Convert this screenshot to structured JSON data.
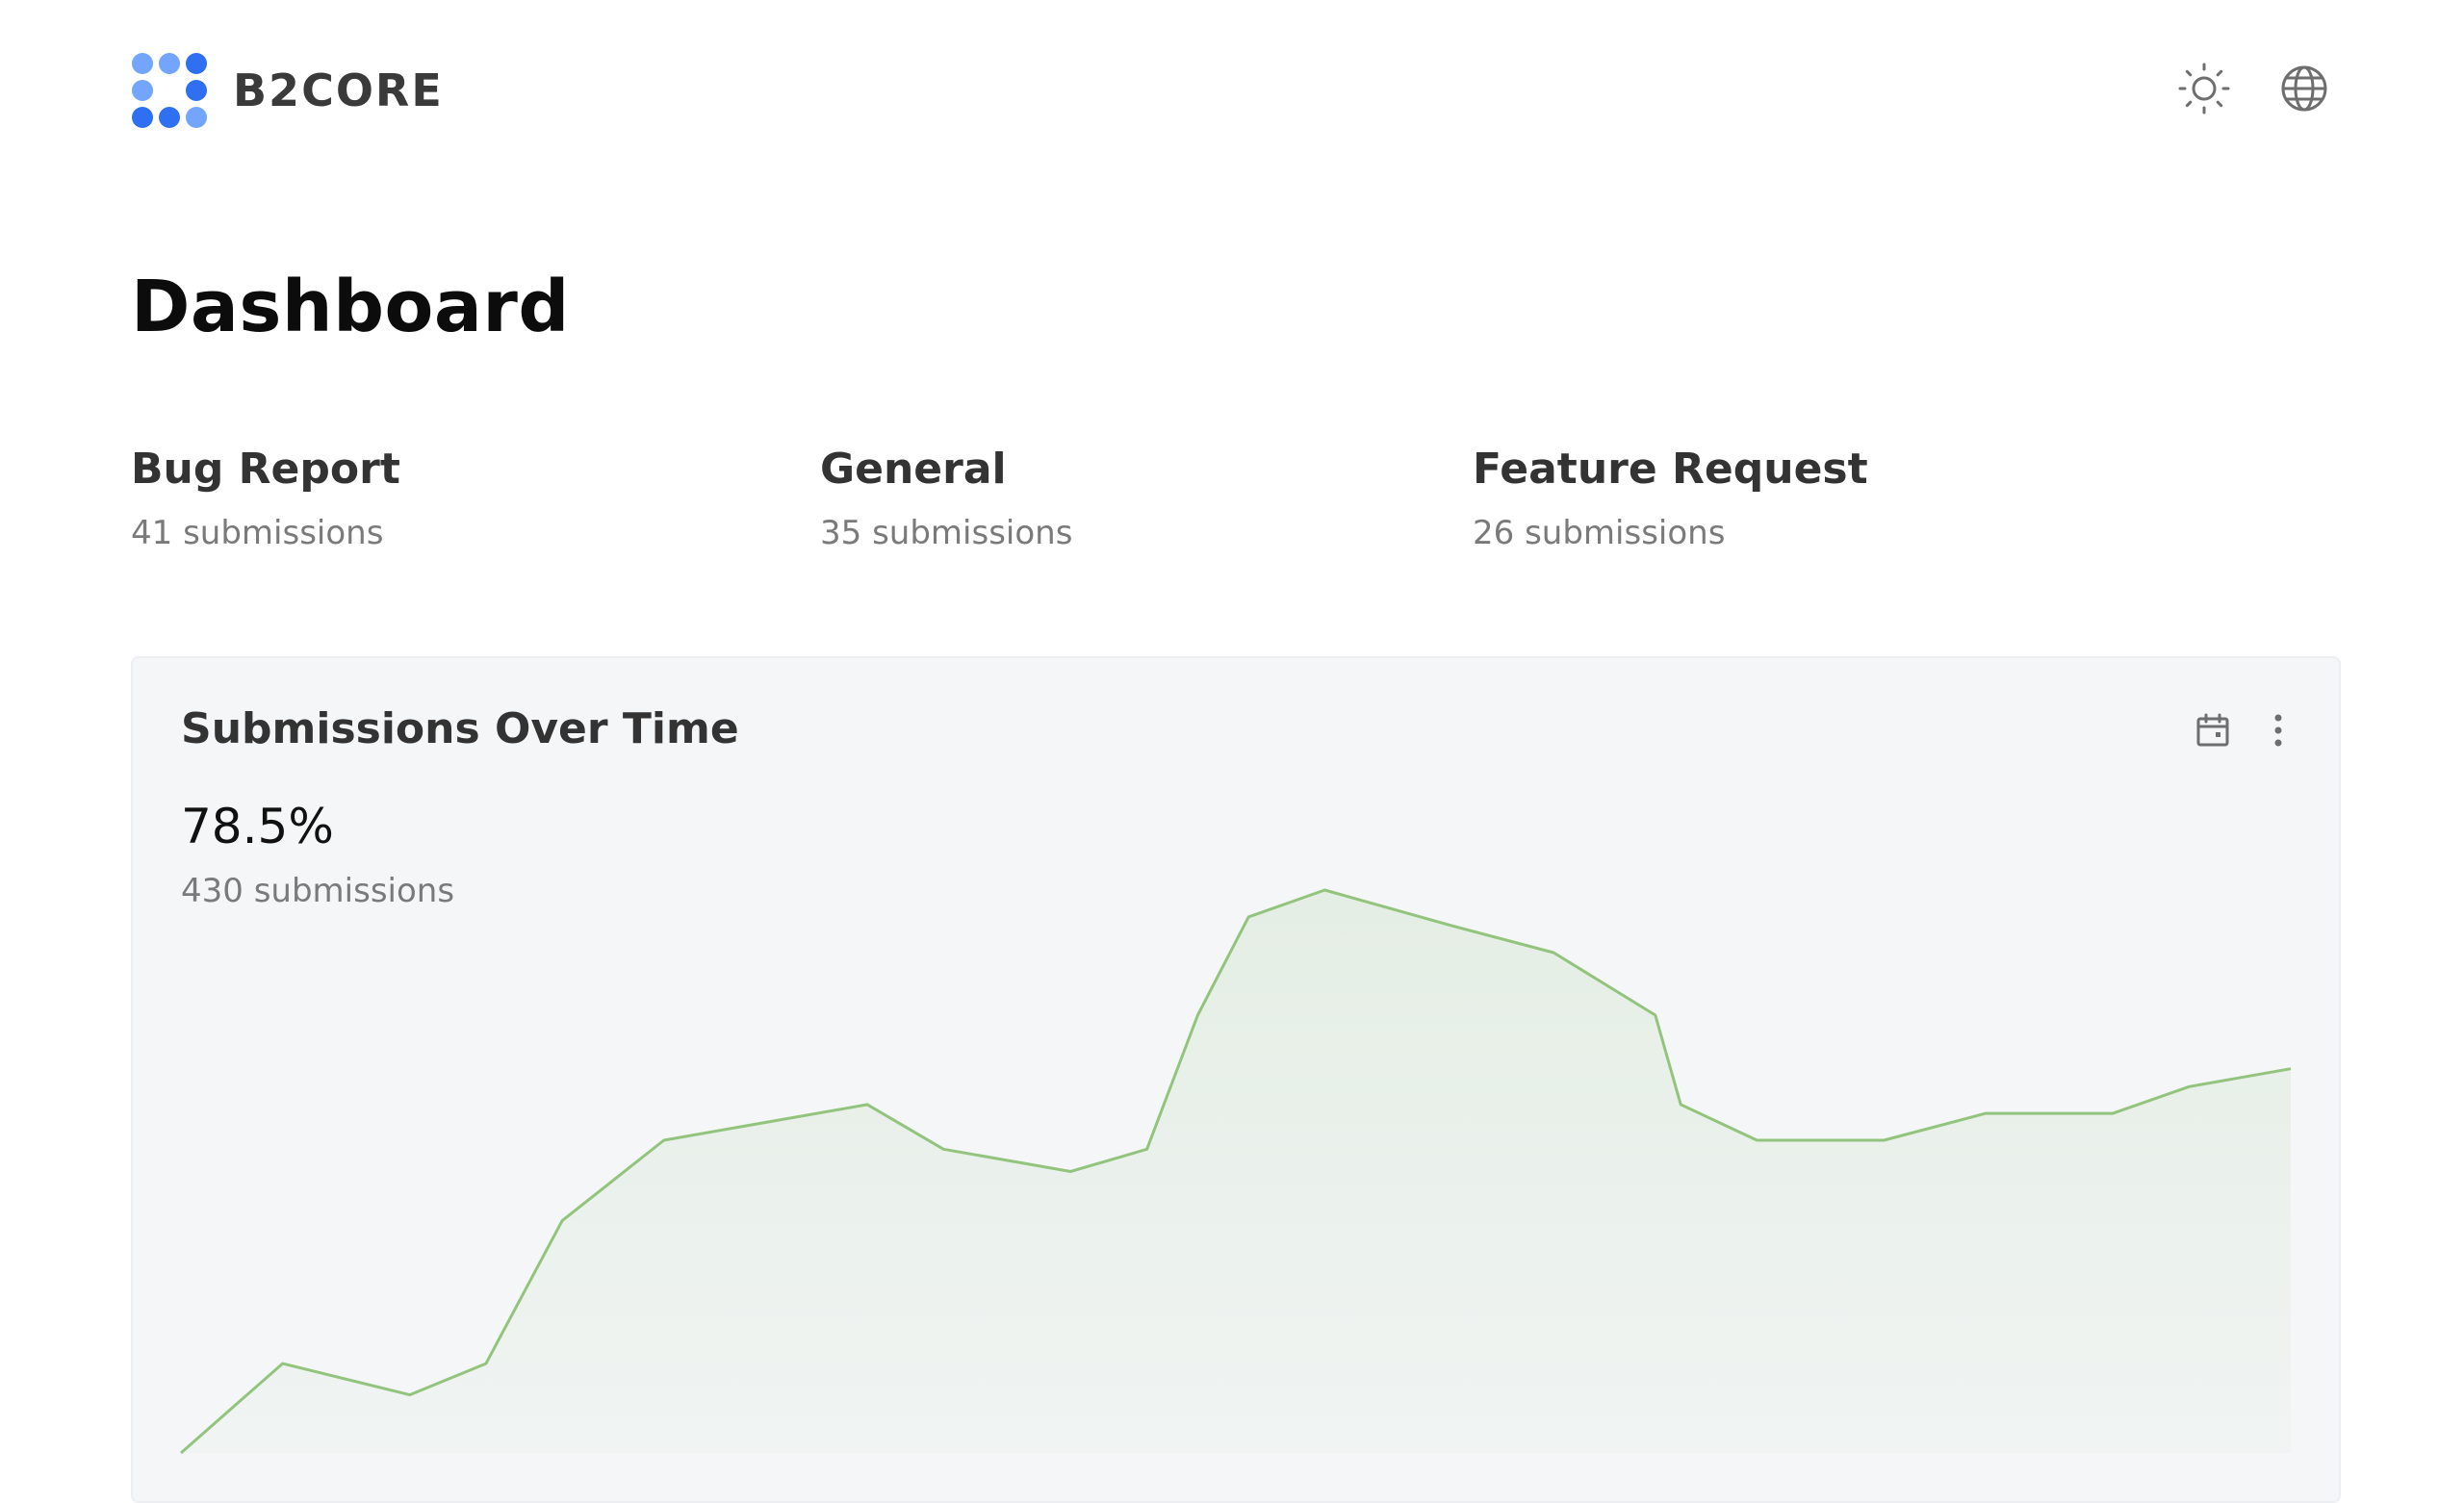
{
  "header": {
    "brand_name": "B2CORE",
    "theme_icon": "sun-icon",
    "language_icon": "globe-icon",
    "brand_colors": [
      "#2f6ff2",
      "#72a5fb"
    ]
  },
  "page": {
    "title": "Dashboard"
  },
  "categories": [
    {
      "name": "Bug Report",
      "count_label": "41 submissions",
      "count": 41
    },
    {
      "name": "General",
      "count_label": "35 submissions",
      "count": 35
    },
    {
      "name": "Feature Request",
      "count_label": "26 submissions",
      "count": 26
    }
  ],
  "chart_card": {
    "title": "Submissions Over Time",
    "metric_value": "78.5%",
    "metric_subtitle": "430 submissions",
    "calendar_icon": "calendar-icon",
    "more_icon": "more-vertical-icon"
  },
  "chart_data": {
    "type": "area",
    "title": "Submissions Over Time",
    "xlabel": "",
    "ylabel": "",
    "grid": false,
    "color": "#93c47d",
    "x": [
      0,
      4,
      9,
      12,
      15,
      19,
      27,
      30,
      35,
      38,
      40,
      42,
      45,
      50,
      54,
      58,
      59,
      62,
      67,
      71,
      76,
      79,
      83
    ],
    "values": [
      0,
      10,
      6.5,
      10,
      26,
      35,
      39,
      34,
      31.5,
      34,
      49,
      60,
      63,
      59,
      56,
      49,
      39,
      35,
      35,
      38,
      38,
      41,
      43
    ],
    "xlim": [
      0,
      83
    ],
    "ylim": [
      0,
      70
    ]
  }
}
